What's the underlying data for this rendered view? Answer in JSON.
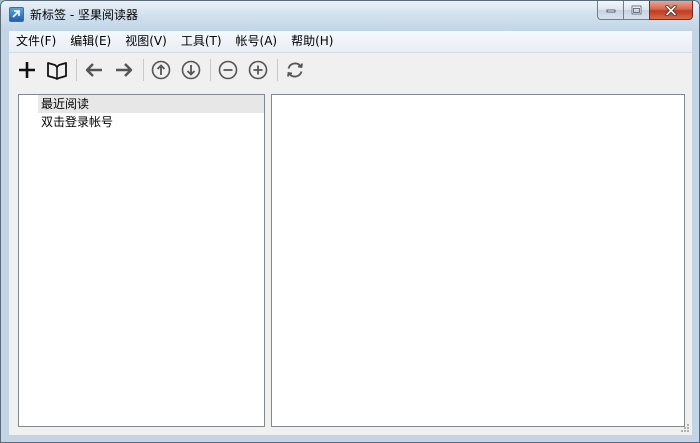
{
  "window": {
    "title": "新标签 - 坚果阅读器",
    "colors": {
      "close_button": "#c23a1f",
      "panel_border": "#828790",
      "selection": "#e7e7e7"
    }
  },
  "menubar": {
    "items": [
      {
        "label": "文件(F)"
      },
      {
        "label": "编辑(E)"
      },
      {
        "label": "视图(V)"
      },
      {
        "label": "工具(T)"
      },
      {
        "label": "帐号(A)"
      },
      {
        "label": "帮助(H)"
      }
    ]
  },
  "toolbar": {
    "buttons": [
      {
        "icon": "plus-icon"
      },
      {
        "icon": "book-icon"
      },
      {
        "icon": "arrow-left-icon"
      },
      {
        "icon": "arrow-right-icon"
      },
      {
        "icon": "circle-arrow-up-icon"
      },
      {
        "icon": "circle-arrow-down-icon"
      },
      {
        "icon": "zoom-out-icon"
      },
      {
        "icon": "zoom-in-icon"
      },
      {
        "icon": "refresh-icon"
      }
    ]
  },
  "sidebar": {
    "items": [
      {
        "label": "最近阅读",
        "selected": true
      },
      {
        "label": "双击登录帐号",
        "selected": false
      }
    ]
  }
}
